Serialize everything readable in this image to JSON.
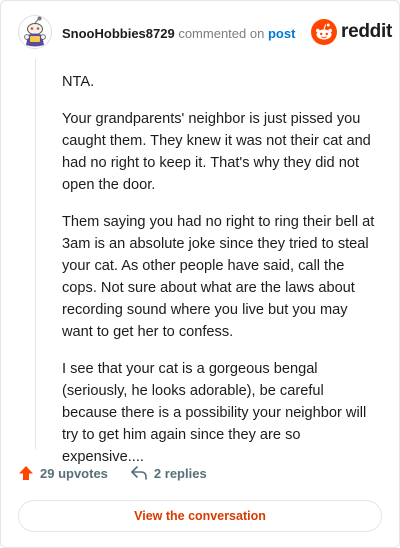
{
  "header": {
    "username": "SnooHobbies8729",
    "commented_on": "commented on",
    "post_link": "post",
    "logo_text": "reddit"
  },
  "comment": {
    "paragraphs": [
      "NTA.",
      "Your grandparents' neighbor is just pissed you caught them. They knew it was not their cat and had no right to keep it. That's why they did not open the door.",
      "Them saying you had no right to ring their bell at 3am is an absolute joke since they tried to steal your cat. As other people have said, call the cops. Not sure about what are the laws about recording sound where you live but you may want to get her to confess.",
      "I see that your cat is a gorgeous bengal (seriously, he looks adorable), be careful because there is a possibility your neighbor will try to get him again since they are so expensive...."
    ]
  },
  "actions": {
    "upvotes": "29 upvotes",
    "replies": "2 replies"
  },
  "footer": {
    "view_conversation": "View the conversation"
  },
  "colors": {
    "brand": "#ff4500",
    "link": "#0079d3",
    "button_text": "#d93a00"
  },
  "icons": {
    "avatar": "snoo-avatar-icon",
    "logo": "reddit-logo-icon",
    "upvote": "upvote-arrow-icon",
    "reply": "reply-arrow-icon"
  }
}
